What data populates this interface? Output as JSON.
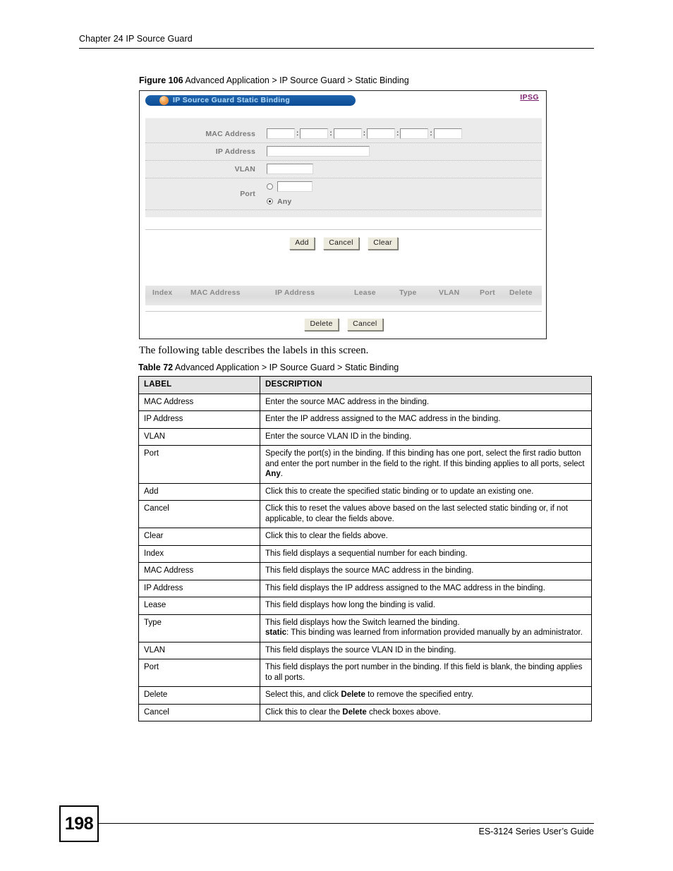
{
  "header": {
    "chapter": "Chapter 24 IP Source Guard"
  },
  "figure": {
    "caption_label": "Figure 106",
    "caption_text": "Advanced Application > IP Source Guard > Static Binding",
    "screen": {
      "title": "IP Source Guard Static Binding",
      "nav_link": "IPSG",
      "title_icon": "orange-orb-icon",
      "accent_title_bg": "#12559f",
      "accent_title_fg": "#a8d4f5",
      "accent_link": "#7b1f6e",
      "panel_bg": "#ebebeb",
      "fields": {
        "mac_address_label": "MAC Address",
        "mac_segments": [
          "",
          "",
          "",
          "",
          "",
          ""
        ],
        "mac_separator": ":",
        "ip_address_label": "IP Address",
        "ip_address_value": "",
        "vlan_label": "VLAN",
        "vlan_value": "",
        "port_label": "Port",
        "port_value": "",
        "port_specific_selected": false,
        "port_any_label": "Any",
        "port_any_selected": true
      },
      "form_buttons": [
        "Add",
        "Cancel",
        "Clear"
      ],
      "results_columns": [
        "Index",
        "MAC Address",
        "IP Address",
        "Lease",
        "Type",
        "VLAN",
        "Port",
        "Delete"
      ],
      "results_rows": [],
      "footer_buttons": [
        "Delete",
        "Cancel"
      ]
    }
  },
  "lead_sentence": "The following table describes the labels in this screen.",
  "table": {
    "caption_label": "Table 72",
    "caption_text": "Advanced Application > IP Source Guard > Static Binding",
    "columns": [
      "LABEL",
      "DESCRIPTION"
    ],
    "rows": [
      {
        "label": "MAC Address",
        "description": "Enter the source MAC address in the binding."
      },
      {
        "label": "IP Address",
        "description": "Enter the IP address assigned to the MAC address in the binding."
      },
      {
        "label": "VLAN",
        "description": "Enter the source VLAN ID in the binding."
      },
      {
        "label": "Port",
        "description": "Specify the port(s) in the binding. If this binding has one port, select the first radio button and enter the port number in the field to the right. If this binding applies to all ports, select <b>Any</b>.",
        "html": true
      },
      {
        "label": "Add",
        "description": "Click this to create the specified static binding or to update an existing one."
      },
      {
        "label": "Cancel",
        "description": "Click this to reset the values above based on the last selected static binding or, if not applicable, to clear the fields above."
      },
      {
        "label": "Clear",
        "description": "Click this to clear the fields above."
      },
      {
        "label": "Index",
        "description": "This field displays a sequential number for each binding."
      },
      {
        "label": "MAC Address",
        "description": "This field displays the source MAC address in the binding."
      },
      {
        "label": "IP Address",
        "description": "This field displays the IP address assigned to the MAC address in the binding."
      },
      {
        "label": "Lease",
        "description": "This field displays how long the binding is valid."
      },
      {
        "label": "Type",
        "description": "This field displays how the Switch learned the binding.<br><b>static</b>: This binding was learned from information provided manually by an administrator.",
        "html": true
      },
      {
        "label": "VLAN",
        "description": "This field displays the source VLAN ID in the binding."
      },
      {
        "label": "Port",
        "description": "This field displays the port number in the binding. If this field is blank, the binding applies to all ports."
      },
      {
        "label": "Delete",
        "description": "Select this, and click <b>Delete</b> to remove the specified entry.",
        "html": true
      },
      {
        "label": "Cancel",
        "description": "Click this to clear the <b>Delete</b> check boxes above.",
        "html": true
      }
    ]
  },
  "footer": {
    "page_number": "198",
    "guide_title": "ES-3124 Series User’s Guide"
  }
}
